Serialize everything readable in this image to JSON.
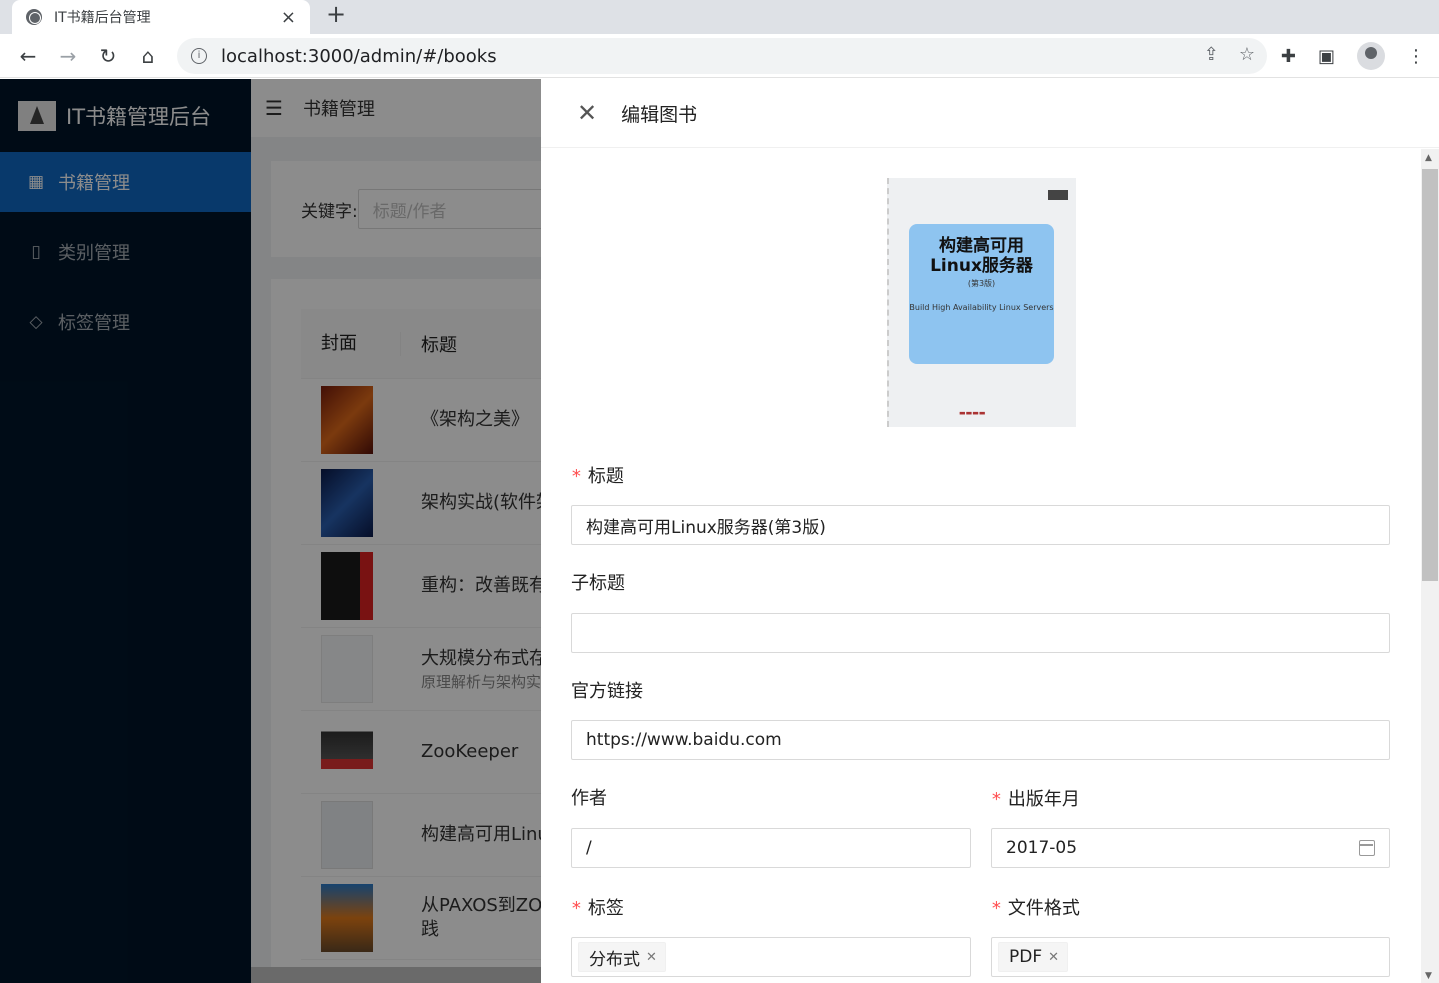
{
  "browser": {
    "tab_title": "IT书籍后台管理",
    "url": "localhost:3000/admin/#/books"
  },
  "app": {
    "brand": "IT书籍管理后台",
    "menu": [
      {
        "label": "书籍管理",
        "icon": "grid-icon",
        "active": true
      },
      {
        "label": "类别管理",
        "icon": "book-icon",
        "active": false
      },
      {
        "label": "标签管理",
        "icon": "tag-icon",
        "active": false
      }
    ],
    "header_title": "书籍管理",
    "search_label": "关键字:",
    "search_placeholder": "标题/作者",
    "table": {
      "columns": [
        "封面",
        "标题"
      ],
      "rows": [
        {
          "title": "《架构之美》",
          "sub": ""
        },
        {
          "title": "架构实战(软件架",
          "sub": ""
        },
        {
          "title": "重构：改善既有",
          "sub": ""
        },
        {
          "title": "大规模分布式存",
          "sub": "原理解析与架构实"
        },
        {
          "title": "ZooKeeper",
          "sub": ""
        },
        {
          "title": "构建高可用Linu",
          "sub": ""
        },
        {
          "title": "从PAXOS到ZOC",
          "sub": "践"
        }
      ]
    }
  },
  "drawer": {
    "title": "编辑图书",
    "cover": {
      "title": "构建高可用\nLinux服务器",
      "edition": "(第3版)",
      "subtitle": "Build High Availability Linux Servers"
    },
    "fields": {
      "title_label": "标题",
      "title_value": "构建高可用Linux服务器(第3版)",
      "subtitle_label": "子标题",
      "subtitle_value": "",
      "link_label": "官方链接",
      "link_value": "https://www.baidu.com",
      "author_label": "作者",
      "author_value": "/",
      "date_label": "出版年月",
      "date_value": "2017-05",
      "tags_label": "标签",
      "tags": [
        "分布式"
      ],
      "format_label": "文件格式",
      "formats": [
        "PDF"
      ]
    }
  },
  "colors": {
    "sidebar_bg": "#001529",
    "menu_active": "#1069c4",
    "required": "#ff4d4f"
  }
}
